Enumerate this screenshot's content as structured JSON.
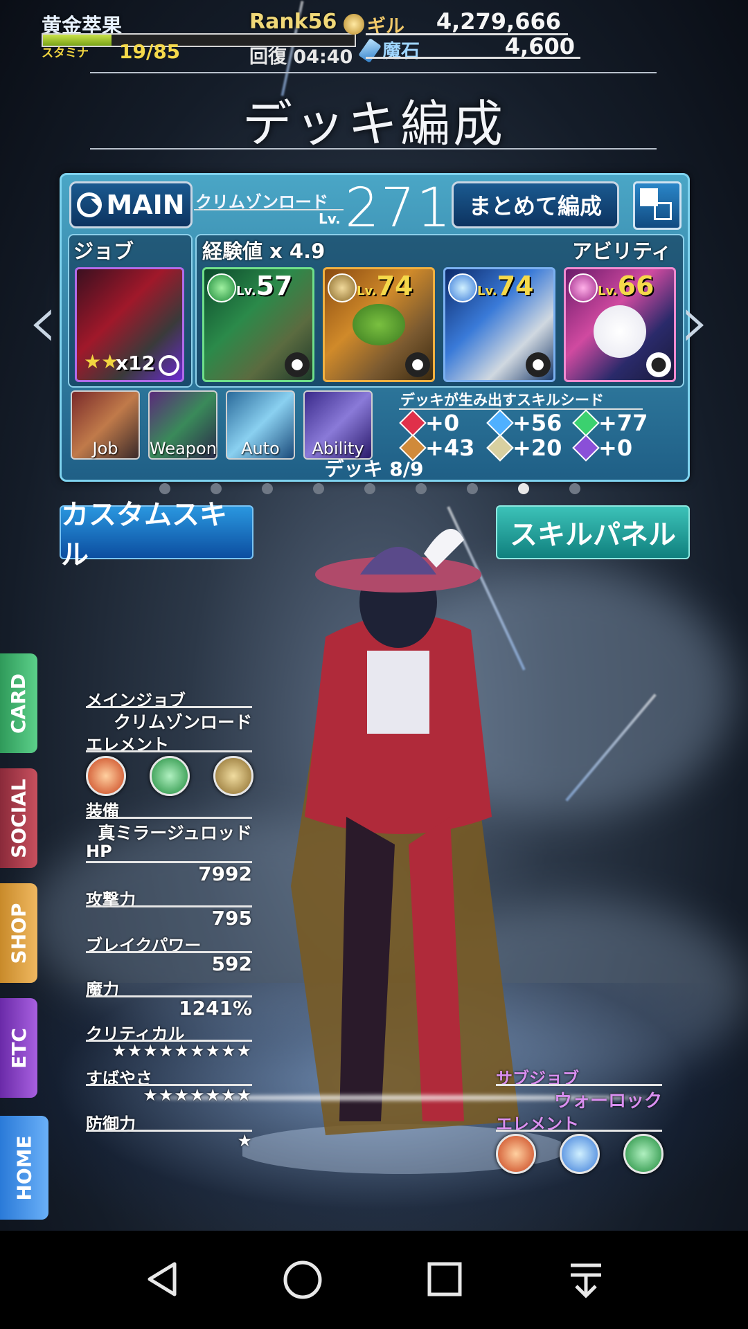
{
  "header": {
    "player_name": "黄金萃果",
    "stamina_label": "スタミナ",
    "stamina_value": "19/85",
    "stamina_fraction": 0.22,
    "rank": "Rank56",
    "gil_label": "ギル",
    "gil_value": "4,279,666",
    "recover": "回復 04:40",
    "stone_label": "魔石",
    "stone_value": "4,600"
  },
  "page_title": "デッキ編成",
  "deck": {
    "main_button": "MAIN",
    "job_name": "クリムゾンロード",
    "lv_label": "Lv.",
    "job_level": "271",
    "matome_button": "まとめて編成",
    "job_section": "ジョブ",
    "exp_label": "経験値 x 4.9",
    "ability_section": "アビリティ",
    "job_card_count": "x12",
    "cards": [
      {
        "lv": "57",
        "theme": "green"
      },
      {
        "lv": "74",
        "theme": "orange"
      },
      {
        "lv": "74",
        "theme": "blue"
      },
      {
        "lv": "66",
        "theme": "pink"
      }
    ],
    "util_buttons": [
      {
        "label": "Job"
      },
      {
        "label": "Weapon"
      },
      {
        "label": "Auto"
      },
      {
        "label": "Ability"
      }
    ],
    "seed_title": "デッキが生み出すスキルシード",
    "seeds": [
      {
        "value": "+0",
        "color": "#e0304a"
      },
      {
        "value": "+56",
        "color": "#4fb0ff"
      },
      {
        "value": "+77",
        "color": "#3bd16f"
      },
      {
        "value": "+43",
        "color": "#d08a3a"
      },
      {
        "value": "+20",
        "color": "#d8d0a0"
      },
      {
        "value": "+0",
        "color": "#8a4fd8"
      }
    ],
    "deck_count": "デッキ 8/9"
  },
  "buttons": {
    "custom_skill": "カスタムスキル",
    "skill_panel": "スキルパネル"
  },
  "side_tabs": [
    "CARD",
    "SOCIAL",
    "SHOP",
    "ETC",
    "HOME"
  ],
  "stats": {
    "main_job_label": "メインジョブ",
    "main_job_value": "クリムゾンロード",
    "element_label": "エレメント",
    "equip_label": "装備",
    "equip_value": "真ミラージュロッド",
    "hp_label": "HP",
    "hp_value": "7992",
    "atk_label": "攻撃力",
    "atk_value": "795",
    "break_label": "ブレイクパワー",
    "break_value": "592",
    "magic_label": "魔力",
    "magic_value": "1241%",
    "crit_label": "クリティカル",
    "crit_value": "★★★★★★★★★",
    "speed_label": "すばやさ",
    "speed_value": "★★★★★★★",
    "def_label": "防御力",
    "def_value": "★"
  },
  "sub": {
    "sub_job_label": "サブジョブ",
    "sub_job_value": "ウォーロック",
    "element_label": "エレメント"
  }
}
